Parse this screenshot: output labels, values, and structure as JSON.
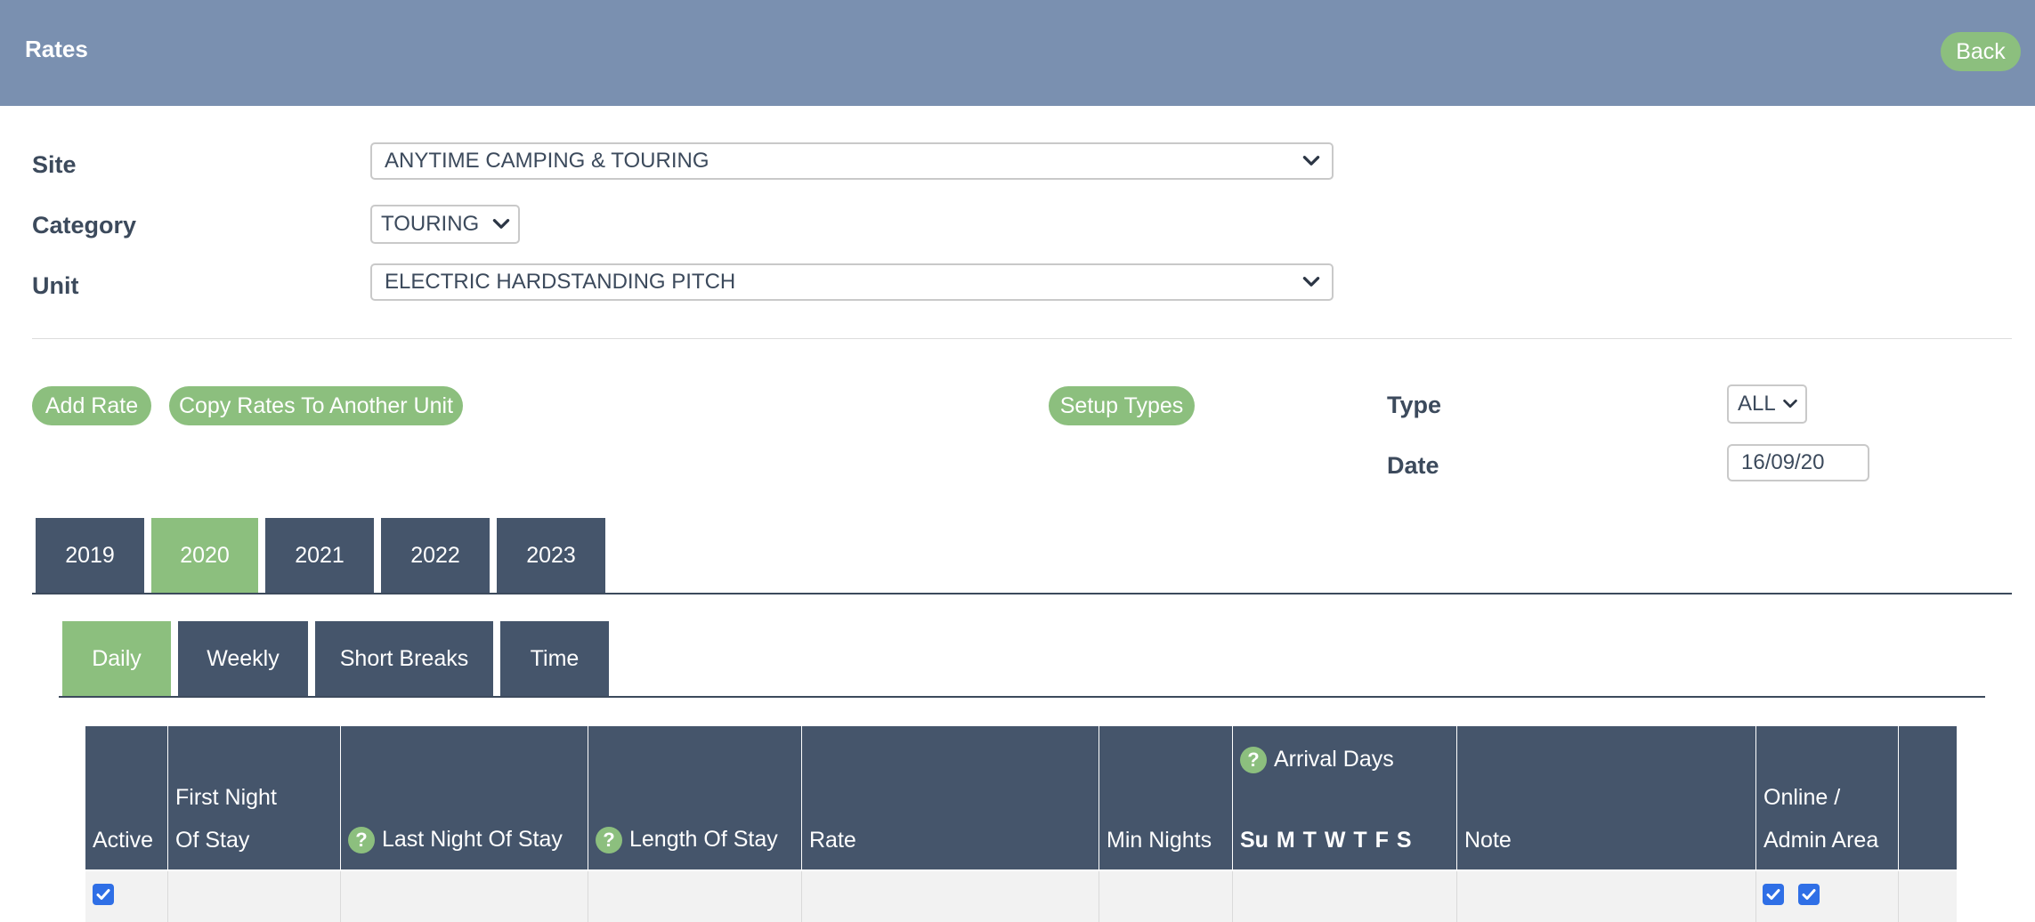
{
  "header": {
    "title": "Rates",
    "back_label": "Back"
  },
  "filters": {
    "site_label": "Site",
    "site_value": "ANYTIME CAMPING & TOURING",
    "category_label": "Category",
    "category_value": "TOURING",
    "unit_label": "Unit",
    "unit_value": "ELECTRIC HARDSTANDING PITCH"
  },
  "actions": {
    "add_rate": "Add Rate",
    "copy_rates": "Copy Rates To Another Unit",
    "setup_types": "Setup Types"
  },
  "type_filter": {
    "label": "Type",
    "value": "ALL"
  },
  "date_filter": {
    "label": "Date",
    "value": "16/09/20"
  },
  "year_tabs": [
    "2019",
    "2020",
    "2021",
    "2022",
    "2023"
  ],
  "active_year": "2020",
  "rate_tabs": [
    "Daily",
    "Weekly",
    "Short Breaks",
    "Time"
  ],
  "active_rate_tab": "Daily",
  "table": {
    "columns": {
      "active": "Active",
      "first_night_1": "First Night",
      "first_night_2": "Of Stay",
      "last_night": "Last Night Of Stay",
      "length_of_stay": "Length Of Stay",
      "rate": "Rate",
      "min_nights": "Min Nights",
      "arrival_days": "Arrival Days",
      "arrival_days_letters": "Su M T W T F S",
      "note": "Note",
      "online_1": "Online /",
      "online_2": "Admin Area"
    },
    "rows": [
      {
        "active": true,
        "online": true,
        "admin": true
      }
    ]
  },
  "colors": {
    "header_bar": "#7a90b0",
    "accent_green": "#8cbf7e",
    "tab_dark": "#45556b",
    "checkbox_blue": "#2f6fe6"
  }
}
